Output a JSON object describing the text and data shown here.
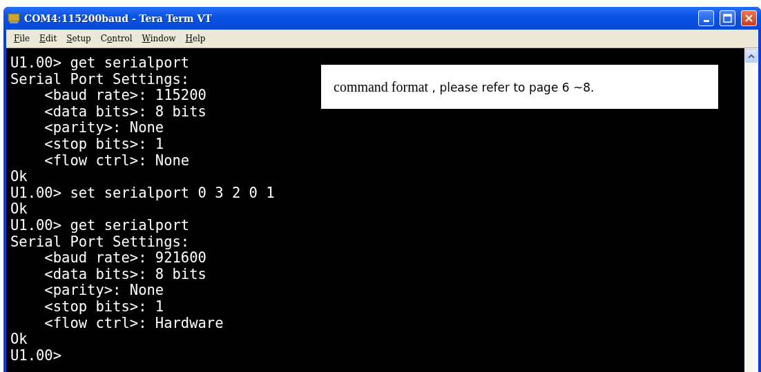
{
  "window": {
    "title": "COM4:115200baud - Tera Term VT"
  },
  "menu": [
    {
      "key": "F",
      "after": "ile"
    },
    {
      "key": "E",
      "after": "dit"
    },
    {
      "key": "S",
      "after": "etup"
    },
    {
      "before": "C",
      "key": "o",
      "after": "ntrol"
    },
    {
      "key": "W",
      "after": "indow"
    },
    {
      "key": "H",
      "after": "elp"
    }
  ],
  "terminal": {
    "lines": [
      "U1.00> get serialport",
      "Serial Port Settings:",
      "    <baud rate>: 115200",
      "    <data bits>: 8 bits",
      "    <parity>: None",
      "    <stop bits>: 1",
      "    <flow ctrl>: None",
      "Ok",
      "U1.00> set serialport 0 3 2 0 1",
      "Ok",
      "U1.00> get serialport",
      "Serial Port Settings:",
      "    <baud rate>: 921600",
      "    <data bits>: 8 bits",
      "    <parity>: None",
      "    <stop bits>: 1",
      "    <flow ctrl>: Hardware",
      "Ok",
      "U1.00>"
    ]
  },
  "note": {
    "parts": [
      "command format",
      " , please refer to page 6 ~8."
    ]
  }
}
